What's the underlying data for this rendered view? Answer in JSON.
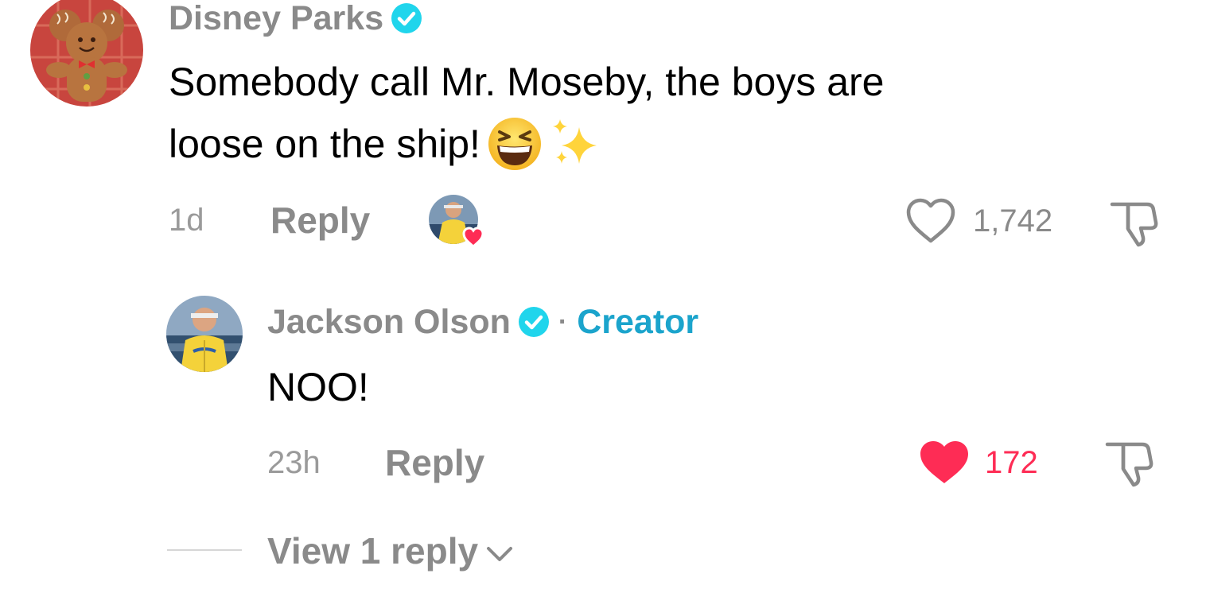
{
  "comments": [
    {
      "author": "Disney Parks",
      "verified": true,
      "avatar_icon": "gingerbread-mickey-avatar",
      "text_line1": "Somebody call Mr. Moseby, the boys are",
      "text_line2": "loose on the ship!",
      "emojis": [
        "grinning-squinting-face-emoji",
        "sparkles-emoji"
      ],
      "time": "1d",
      "reply_label": "Reply",
      "creator_liked": true,
      "likes": "1,742",
      "liked": false
    },
    {
      "author": "Jackson Olson",
      "verified": true,
      "separator": "·",
      "creator_tag": "Creator",
      "avatar_icon": "baseball-player-avatar",
      "text": "NOO!",
      "time": "23h",
      "reply_label": "Reply",
      "likes": "172",
      "liked": true
    }
  ],
  "view_replies_label": "View 1 reply",
  "colors": {
    "like_active": "#fe2c55",
    "creator_tag": "#1ba4cc",
    "verified_badge": "#20d5ec",
    "muted_text": "#8a8a8a"
  }
}
